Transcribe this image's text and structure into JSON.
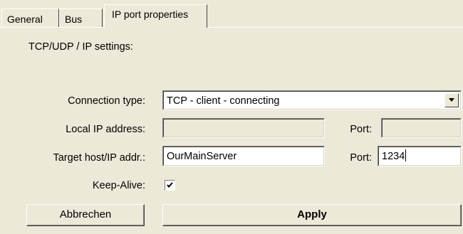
{
  "tabs": [
    {
      "label": "General",
      "active": false
    },
    {
      "label": "Bus",
      "active": false
    },
    {
      "label": "IP port properties",
      "active": true
    }
  ],
  "section_title": "TCP/UDP / IP settings:",
  "connection_type": {
    "label": "Connection type:",
    "value": "TCP - client - connecting",
    "arrow_icon": "chevron-down-icon"
  },
  "local_ip": {
    "label": "Local IP address:",
    "value": "",
    "enabled": false,
    "port_label": "Port:",
    "port_value": ""
  },
  "target_host": {
    "label": "Target host/IP addr.:",
    "value": "OurMainServer",
    "port_label": "Port:",
    "port_value": "1234"
  },
  "keep_alive": {
    "label": "Keep-Alive:",
    "checked": true,
    "icon": "checkmark-icon"
  },
  "buttons": {
    "cancel": "Abbrechen",
    "apply": "Apply"
  },
  "colors": {
    "face": "#ece9d8",
    "field": "#ffffff",
    "shadow": "#808080",
    "dark_shadow": "#404040",
    "highlight": "#ffffff"
  }
}
